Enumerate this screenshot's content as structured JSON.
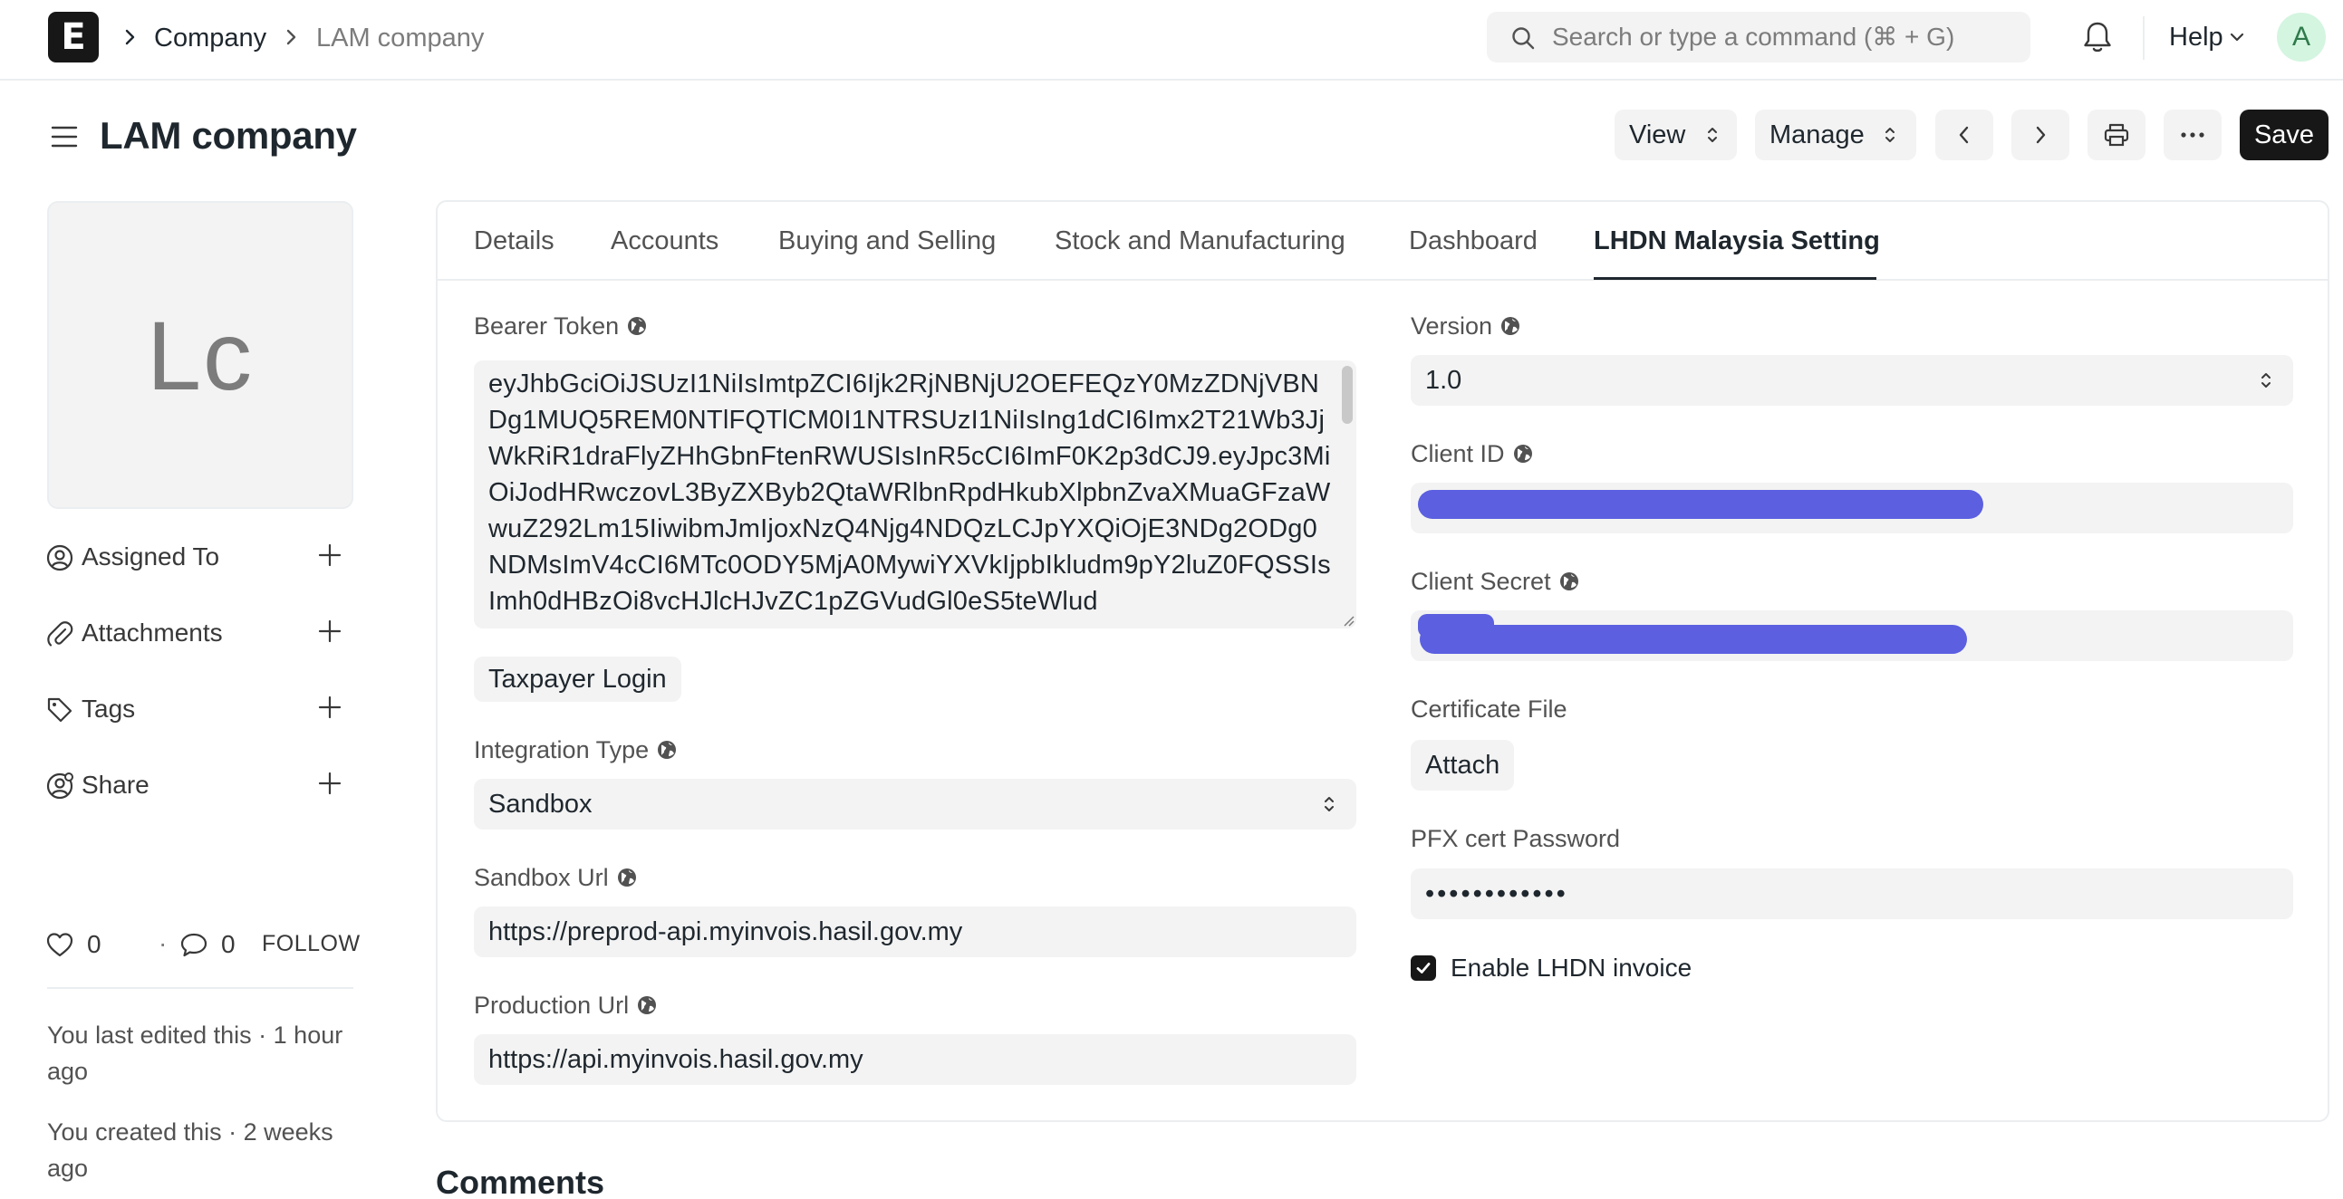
{
  "navbar": {
    "logo_letter": "E",
    "breadcrumbs": [
      "Company",
      "LAM company"
    ],
    "search_placeholder": "Search or type a command (⌘ + G)",
    "help_label": "Help",
    "avatar_initial": "A"
  },
  "header": {
    "title": "LAM company",
    "view_label": "View",
    "manage_label": "Manage",
    "save_label": "Save"
  },
  "sidebar": {
    "image_initials": "Lc",
    "items": [
      {
        "label": "Assigned To",
        "icon": "user-circle-icon"
      },
      {
        "label": "Attachments",
        "icon": "paperclip-icon"
      },
      {
        "label": "Tags",
        "icon": "tag-icon"
      },
      {
        "label": "Share",
        "icon": "share-user-icon"
      }
    ],
    "likes": "0",
    "comments": "0",
    "follow_label": "FOLLOW",
    "last_edited": "You last edited this · 1 hour ago",
    "created": "You created this · 2 weeks ago"
  },
  "tabs": [
    "Details",
    "Accounts",
    "Buying and Selling",
    "Stock and Manufacturing",
    "Dashboard",
    "LHDN Malaysia Setting"
  ],
  "active_tab": "LHDN Malaysia Setting",
  "form": {
    "bearer_token_label": "Bearer Token",
    "bearer_token_value": "eyJhbGciOiJSUzI1NiIsImtpZCI6Ijk2RjNBNjU2OEFEQzY0MzZDNjVBNDg1MUQ5REM0NTlFQTlCM0I1NTRSUzI1NiIsIng1dCI6Imx2T21Wb3JjWkRiR1draFlyZHhGbnFtenRWUSIsInR5cCI6ImF0K2p3dCJ9.eyJpc3MiOiJodHRwczovL3ByZXByb2QtaWRlbnRpdHkubXlpbnZvaXMuaGFzaWwuZ292Lm15IiwibmJmIjoxNzQ4Njg4NDQzLCJpYXQiOjE3NDg2ODg0NDMsImV4cCI6MTc0ODY5MjA0MywiYXVkIjpbIkludm9pY2luZ0FQSSIsImh0dHBzOi8vcHJlcHJvZC1pZGVudGl0eS5teWlud",
    "taxpayer_login_label": "Taxpayer Login",
    "integration_type_label": "Integration Type",
    "integration_type_value": "Sandbox",
    "sandbox_url_label": "Sandbox Url",
    "sandbox_url_value": "https://preprod-api.myinvois.hasil.gov.my",
    "production_url_label": "Production Url",
    "production_url_value": "https://api.myinvois.hasil.gov.my",
    "version_label": "Version",
    "version_value": "1.0",
    "client_id_label": "Client ID",
    "client_secret_label": "Client Secret",
    "certificate_file_label": "Certificate File",
    "attach_label": "Attach",
    "pfx_password_label": "PFX cert Password",
    "pfx_password_value": "••••••••••••",
    "enable_lhdn_label": "Enable LHDN invoice",
    "enable_lhdn_checked": true
  },
  "comments_title": "Comments",
  "colors": {
    "accent_dark": "#171717",
    "field_bg": "#f3f3f3",
    "redaction": "#5b5fe0"
  }
}
